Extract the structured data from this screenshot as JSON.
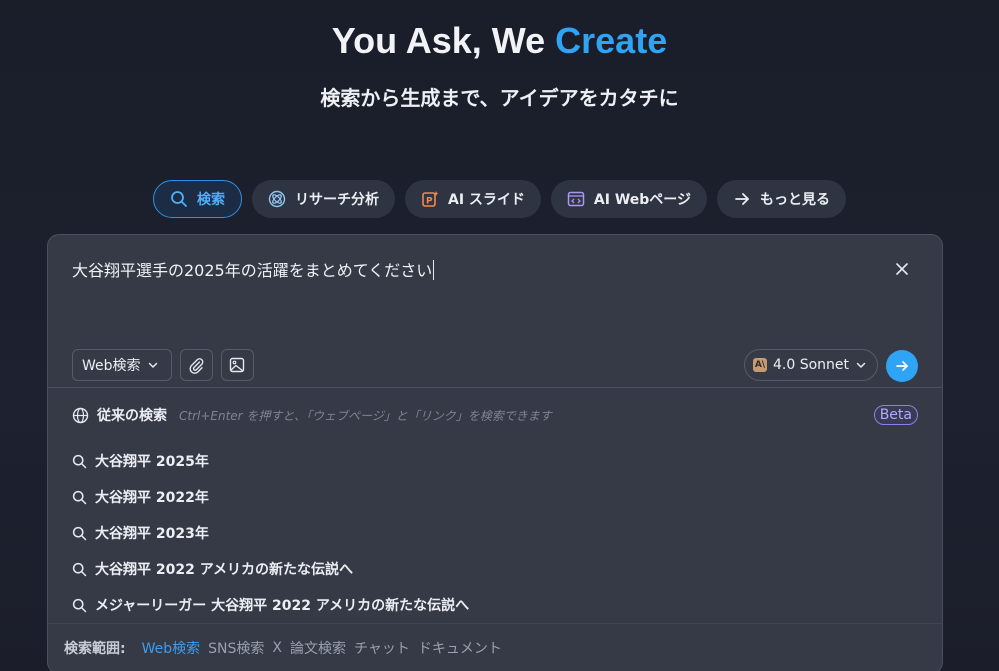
{
  "hero": {
    "title_prefix": "You Ask, We ",
    "title_accent": "Create",
    "subtitle": "検索から生成まで、アイデアをカタチに"
  },
  "tabs": [
    {
      "label": "検索",
      "icon": "search-icon",
      "active": true
    },
    {
      "label": "リサーチ分析",
      "icon": "atom-icon"
    },
    {
      "label": "AI スライド",
      "icon": "slide-icon"
    },
    {
      "label": "AI Webページ",
      "icon": "webpage-icon"
    },
    {
      "label": "もっと見る",
      "icon": "arrow-right-icon"
    }
  ],
  "input": {
    "value": "大谷翔平選手の2025年の活躍をまとめてください"
  },
  "toolbar": {
    "source_select": "Web検索",
    "model": "4.0 Sonnet",
    "model_logo": "A\\"
  },
  "legacy": {
    "label": "従来の検索",
    "hint": "Ctrl+Enter を押すと、「ウェブページ」と「リンク」を検索できます",
    "badge": "Beta"
  },
  "suggestions": [
    "大谷翔平 2025年",
    "大谷翔平 2022年",
    "大谷翔平 2023年",
    "大谷翔平 2022 アメリカの新たな伝説へ",
    "メジャーリーガー 大谷翔平 2022 アメリカの新たな伝説へ"
  ],
  "scope": {
    "title": "検索範囲:",
    "options": [
      "Web検索",
      "SNS検索",
      "X",
      "論文検索",
      "チャット",
      "ドキュメント"
    ],
    "active_index": 0
  },
  "colors": {
    "accent": "#2fa3f4",
    "background": "#1b1f2b",
    "panel": "#353a46"
  }
}
